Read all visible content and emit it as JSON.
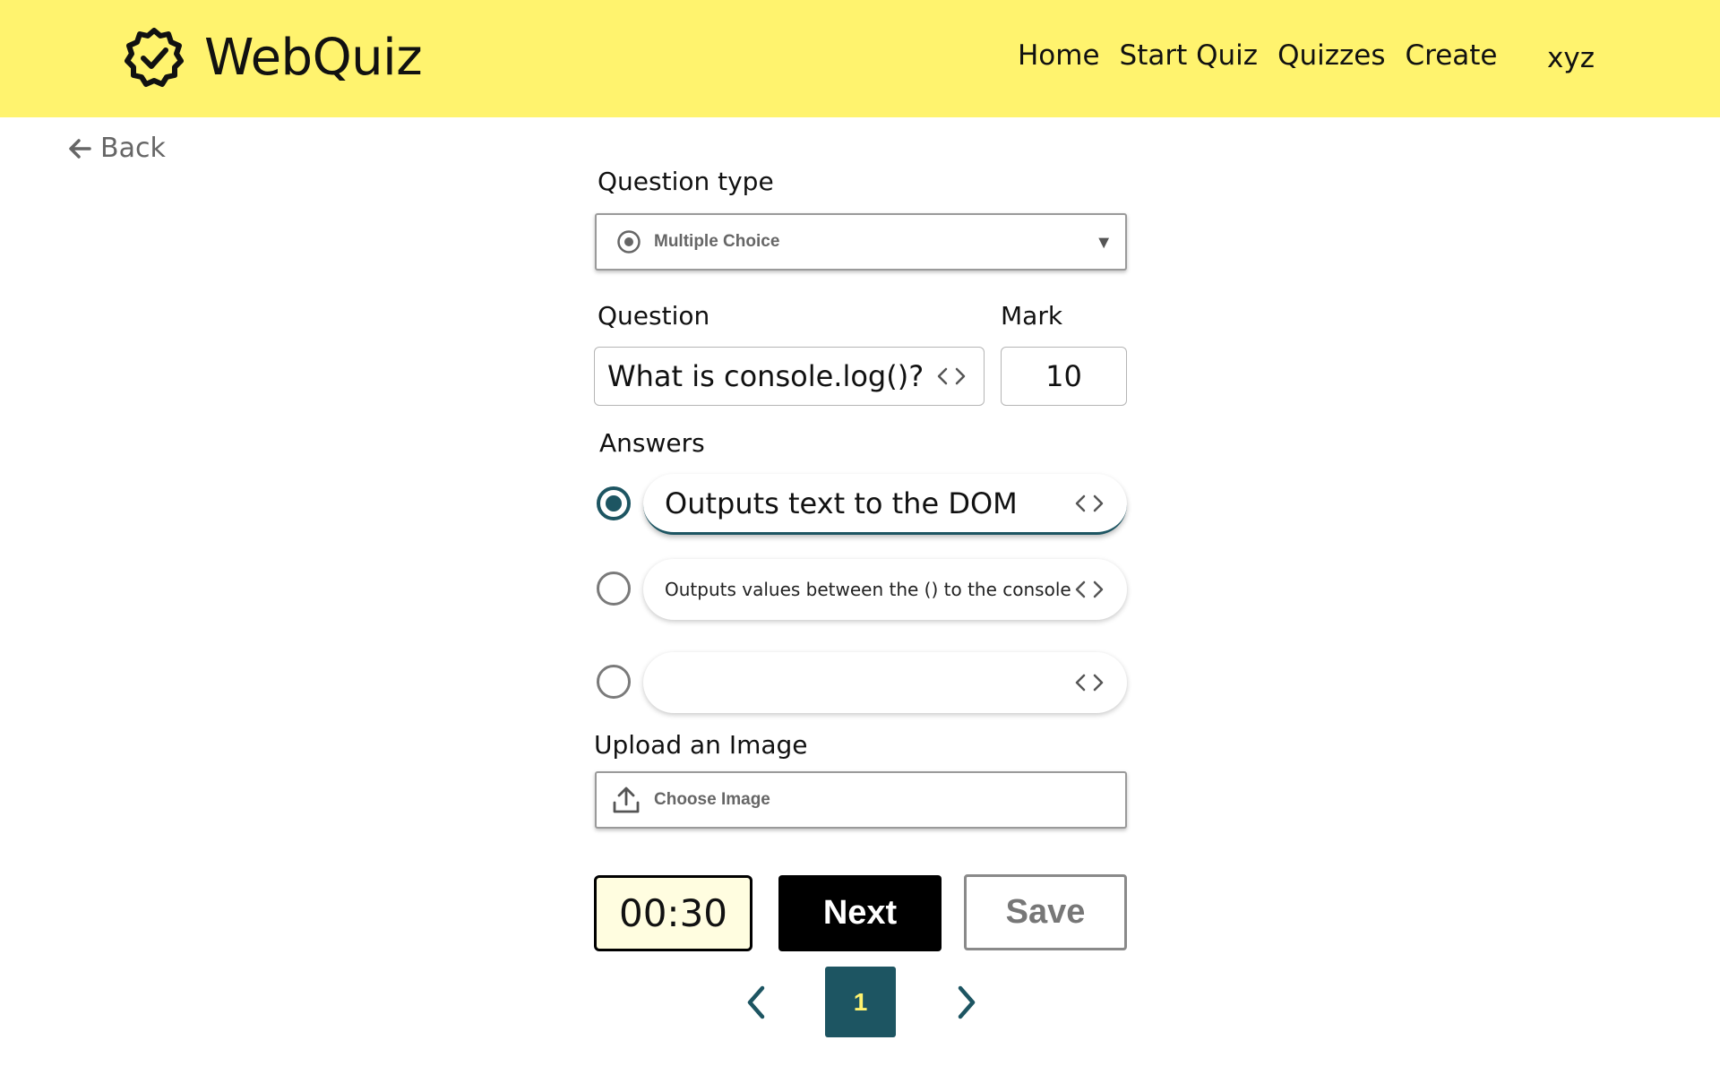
{
  "app": {
    "title": "WebQuiz"
  },
  "nav": {
    "items": [
      {
        "label": "Home"
      },
      {
        "label": "Start Quiz"
      },
      {
        "label": "Quizzes"
      },
      {
        "label": "Create"
      }
    ],
    "user": "xyz"
  },
  "back": {
    "label": "Back"
  },
  "form": {
    "question_type": {
      "label": "Question type",
      "value": "Multiple Choice"
    },
    "question": {
      "label": "Question",
      "value": "What is console.log()?"
    },
    "mark": {
      "label": "Mark",
      "value": "10"
    },
    "answers": {
      "label": "Answers",
      "items": [
        {
          "text": "Outputs text to the DOM",
          "checked": true
        },
        {
          "text": "Outputs values between the () to the console",
          "checked": false
        },
        {
          "text": "",
          "checked": false
        }
      ]
    },
    "upload": {
      "label": "Upload an Image",
      "button": "Choose Image"
    }
  },
  "actions": {
    "timer": "00:30",
    "next": "Next",
    "save": "Save"
  },
  "pagination": {
    "current": "1"
  },
  "colors": {
    "header_bg": "#fff36e",
    "accent": "#1d5562",
    "timer_bg": "#fffde0"
  },
  "icons": {
    "logo": "badge-check-icon",
    "back": "arrow-left-icon",
    "select": "radio-icon",
    "code": "code-brackets-icon",
    "upload": "upload-icon",
    "prev": "chevron-left-icon",
    "next": "chevron-right-icon"
  }
}
